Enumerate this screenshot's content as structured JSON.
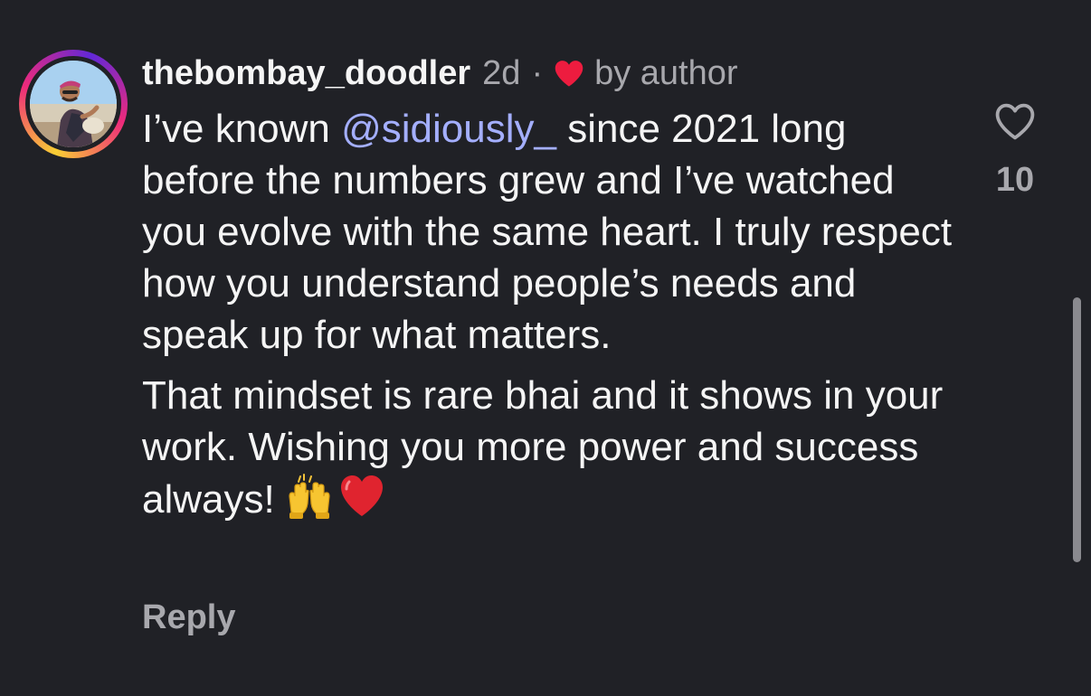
{
  "comment": {
    "username": "thebombay_doodler",
    "time_ago": "2d",
    "separator": "·",
    "liked_by": "by author",
    "body": {
      "p1_before_mention": "I’ve known ",
      "mention": "@sidiously_",
      "p1_after_mention": " since 2021 long before the numbers grew and I’ve watched you evolve with the same heart. I truly respect how you understand people’s needs and speak up for what matters.",
      "p2_text": "That mindset is rare bhai and it shows in your work. Wishing you more power and success always! "
    },
    "reply_label": "Reply",
    "like_count": "10"
  },
  "icons": {
    "liked_by_author": "red-heart-icon",
    "like": "heart-outline-icon",
    "emoji_1": "raising-hands-emoji",
    "emoji_2": "red-heart-emoji"
  },
  "colors": {
    "background": "#202126",
    "text": "#f5f5f5",
    "muted": "#a8a8ad",
    "mention": "#a4afff",
    "heart": "#ed1c3f"
  }
}
